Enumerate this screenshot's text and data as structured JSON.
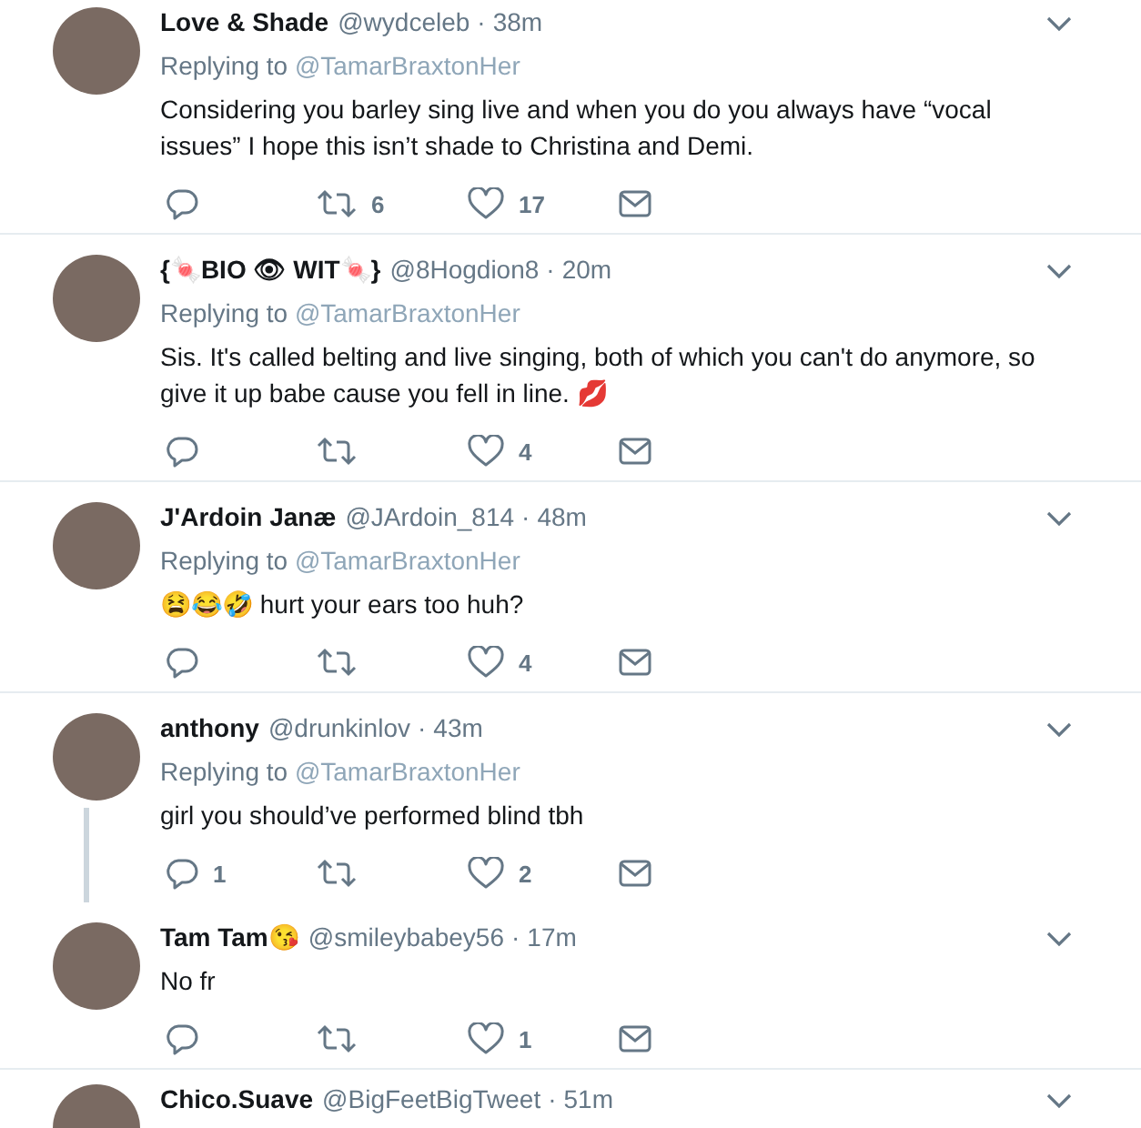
{
  "tweets": [
    {
      "name": "Love & Shade",
      "handle": "@wydceleb",
      "separator": "·",
      "time": "38m",
      "replying_label": "Replying to",
      "replying_to": "@TamarBraxtonHer",
      "text": "Considering you barley sing live and when you do you always have “vocal issues” I hope this isn’t shade to Christina and Demi.",
      "retweets": "6",
      "likes": "17",
      "thread": false
    },
    {
      "name": "{🍬BIO 👁 WIT🍬}",
      "handle": "@8Hogdion8",
      "separator": "·",
      "time": "20m",
      "replying_label": "Replying to",
      "replying_to": "@TamarBraxtonHer",
      "text": "Sis. It's called belting and live singing, both of which you can't do anymore, so give it up babe cause you fell in line. 💋",
      "likes": "4",
      "thread": false
    },
    {
      "name": "J'Ardoin Janæ",
      "handle": "@JArdoin_814",
      "separator": "·",
      "time": "48m",
      "replying_label": "Replying to",
      "replying_to": "@TamarBraxtonHer",
      "text": "😫😂🤣 hurt your ears too huh?",
      "likes": "4",
      "thread": false
    },
    {
      "name": "anthony",
      "handle": "@drunkinlov",
      "separator": "·",
      "time": "43m",
      "replying_label": "Replying to",
      "replying_to": "@TamarBraxtonHer",
      "text": "girl you should’ve performed blind tbh",
      "replies": "1",
      "likes": "2",
      "thread": true
    },
    {
      "name": "Tam Tam😘",
      "handle": "@smileybabey56",
      "separator": "·",
      "time": "17m",
      "text": "No fr",
      "likes": "1",
      "thread": false
    },
    {
      "name": "Chico.Suave",
      "handle": "@BigFeetBigTweet",
      "separator": "·",
      "time": "51m"
    }
  ]
}
